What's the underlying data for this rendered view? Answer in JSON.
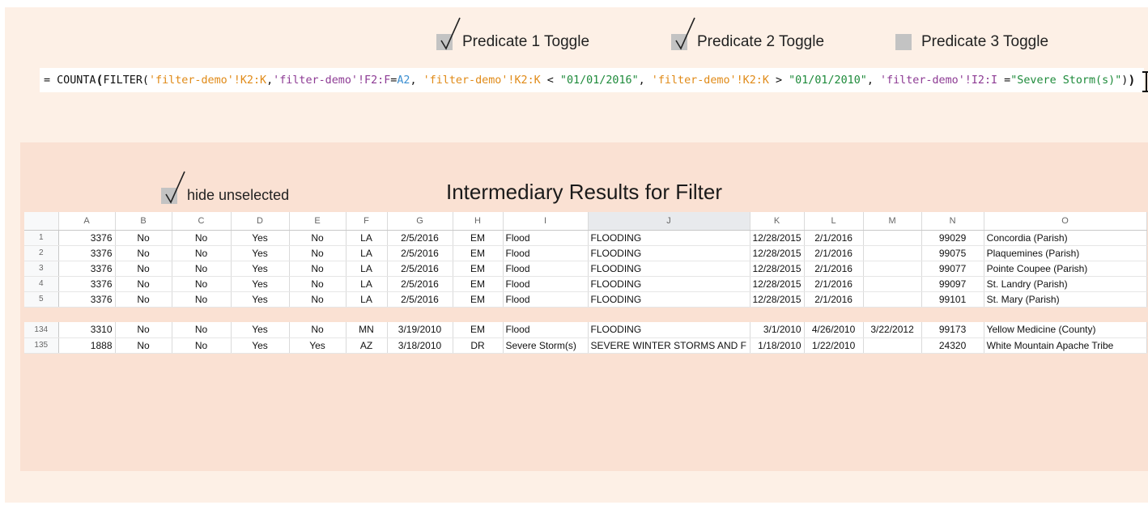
{
  "toggles": [
    {
      "label": "Predicate 1 Toggle",
      "checked": true
    },
    {
      "label": "Predicate 2 Toggle",
      "checked": true
    },
    {
      "label": "Predicate 3 Toggle",
      "checked": false
    }
  ],
  "hide_toggle": {
    "label": "hide unselected",
    "checked": true
  },
  "formula_tokens": [
    {
      "text": "= COUNTA",
      "cls": "f-plain"
    },
    {
      "text": "(",
      "cls": "f-bold"
    },
    {
      "text": "FILTER(",
      "cls": "f-plain"
    },
    {
      "text": "'filter-demo'!K2:K",
      "cls": "f-orange"
    },
    {
      "text": ",",
      "cls": "f-plain"
    },
    {
      "text": "'filter-demo'!F2:F",
      "cls": "f-purple"
    },
    {
      "text": "=",
      "cls": "f-plain"
    },
    {
      "text": "A2",
      "cls": "f-blue"
    },
    {
      "text": ", ",
      "cls": "f-plain"
    },
    {
      "text": "'filter-demo'!K2:K",
      "cls": "f-orange"
    },
    {
      "text": " < ",
      "cls": "f-plain"
    },
    {
      "text": "\"01/01/2016\"",
      "cls": "f-green"
    },
    {
      "text": ", ",
      "cls": "f-plain"
    },
    {
      "text": "'filter-demo'!K2:K",
      "cls": "f-orange"
    },
    {
      "text": " > ",
      "cls": "f-plain"
    },
    {
      "text": "\"01/01/2010\"",
      "cls": "f-green"
    },
    {
      "text": ", ",
      "cls": "f-plain"
    },
    {
      "text": "'filter-demo'!I2:I",
      "cls": "f-purple"
    },
    {
      "text": " =",
      "cls": "f-plain"
    },
    {
      "text": "\"Severe Storm(s)\"",
      "cls": "f-green"
    },
    {
      "text": ")",
      "cls": "f-plain"
    },
    {
      "text": ")",
      "cls": "f-bold"
    }
  ],
  "panel_title": "Intermediary Results for Filter",
  "sheet": {
    "columns": [
      "A",
      "B",
      "C",
      "D",
      "E",
      "F",
      "G",
      "H",
      "I",
      "J",
      "K",
      "L",
      "M",
      "N",
      "O"
    ],
    "selected_column": "J",
    "rows": [
      {
        "num": "1",
        "cells": [
          "3376",
          "No",
          "No",
          "Yes",
          "No",
          "LA",
          "2/5/2016",
          "EM",
          "Flood",
          "FLOODING",
          "12/28/2015",
          "2/1/2016",
          "",
          "99029",
          "Concordia (Parish)"
        ]
      },
      {
        "num": "2",
        "cells": [
          "3376",
          "No",
          "No",
          "Yes",
          "No",
          "LA",
          "2/5/2016",
          "EM",
          "Flood",
          "FLOODING",
          "12/28/2015",
          "2/1/2016",
          "",
          "99075",
          "Plaquemines (Parish)"
        ]
      },
      {
        "num": "3",
        "cells": [
          "3376",
          "No",
          "No",
          "Yes",
          "No",
          "LA",
          "2/5/2016",
          "EM",
          "Flood",
          "FLOODING",
          "12/28/2015",
          "2/1/2016",
          "",
          "99077",
          "Pointe Coupee (Parish)"
        ]
      },
      {
        "num": "4",
        "cells": [
          "3376",
          "No",
          "No",
          "Yes",
          "No",
          "LA",
          "2/5/2016",
          "EM",
          "Flood",
          "FLOODING",
          "12/28/2015",
          "2/1/2016",
          "",
          "99097",
          "St. Landry (Parish)"
        ]
      },
      {
        "num": "5",
        "cells": [
          "3376",
          "No",
          "No",
          "Yes",
          "No",
          "LA",
          "2/5/2016",
          "EM",
          "Flood",
          "FLOODING",
          "12/28/2015",
          "2/1/2016",
          "",
          "99101",
          "St. Mary (Parish)"
        ]
      },
      {
        "gap": true
      },
      {
        "num": "134",
        "cells": [
          "3310",
          "No",
          "No",
          "Yes",
          "No",
          "MN",
          "3/19/2010",
          "EM",
          "Flood",
          "FLOODING",
          "3/1/2010",
          "4/26/2010",
          "3/22/2012",
          "99173",
          "Yellow Medicine (County)"
        ]
      },
      {
        "num": "135",
        "cells": [
          "1888",
          "No",
          "No",
          "Yes",
          "Yes",
          "AZ",
          "3/18/2010",
          "DR",
          "Severe Storm(s)",
          "SEVERE WINTER STORMS AND F",
          "1/18/2010",
          "1/22/2010",
          "",
          "24320",
          "White Mountain Apache Tribe"
        ]
      }
    ]
  }
}
